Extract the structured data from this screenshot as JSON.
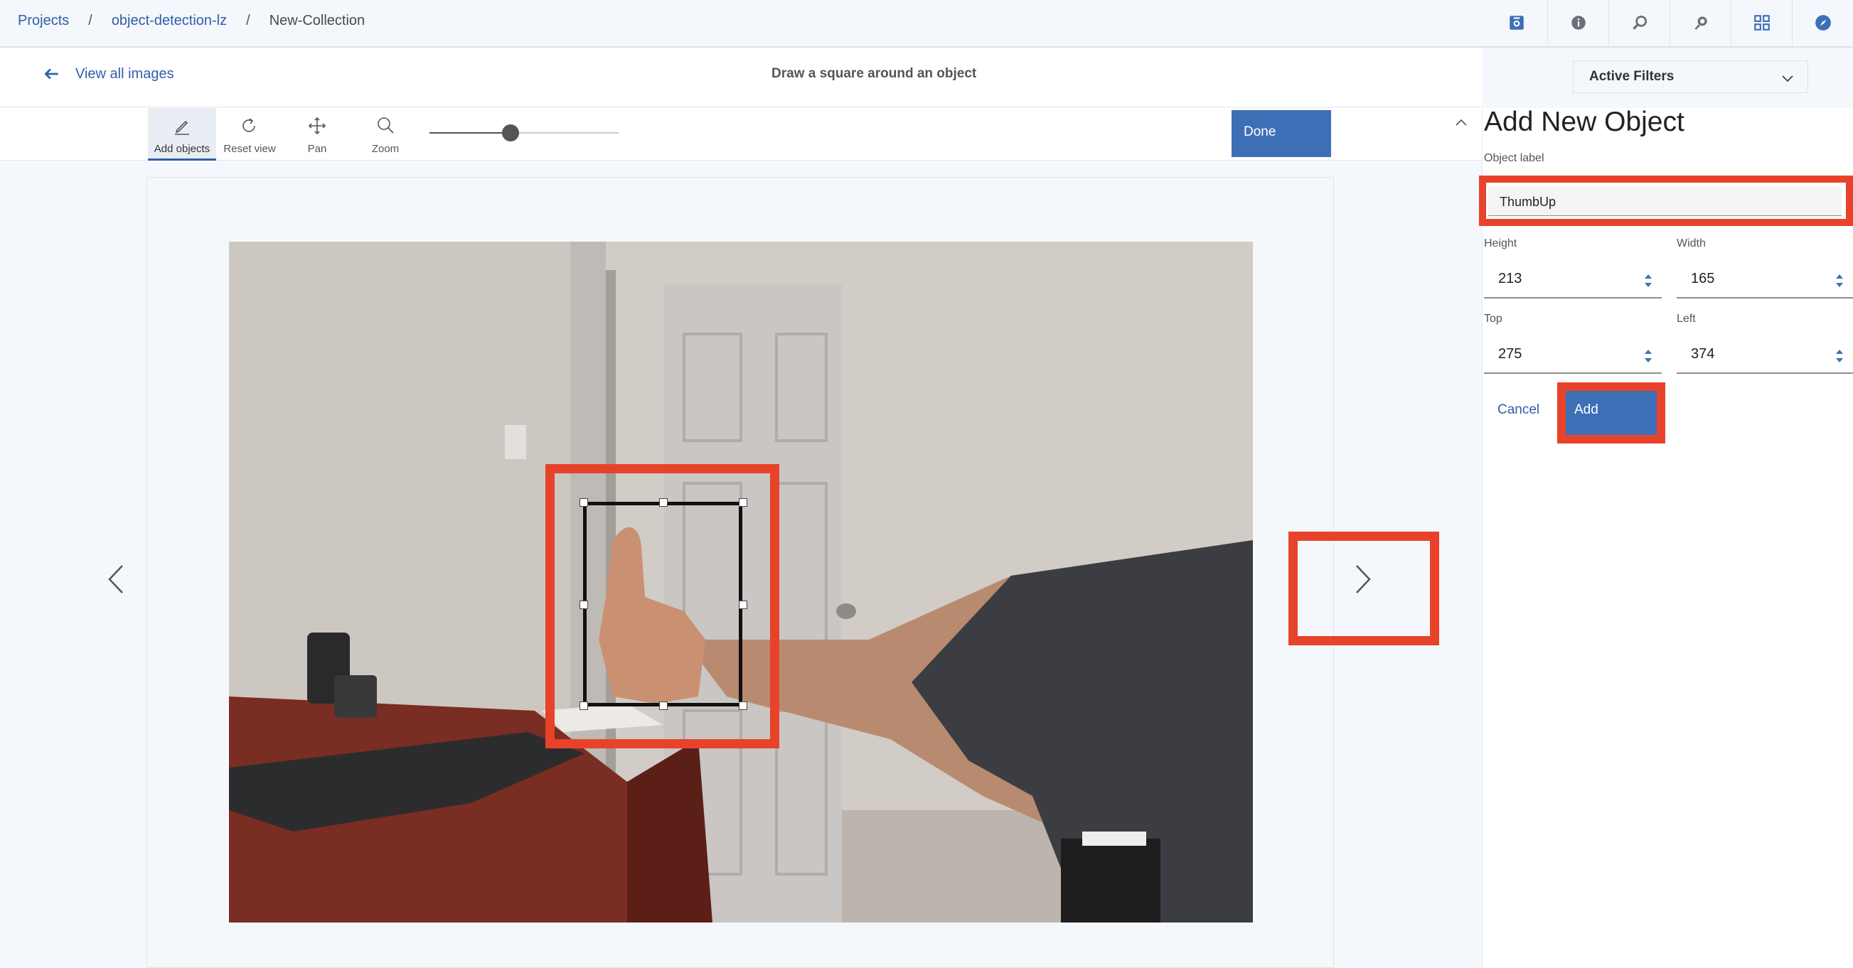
{
  "breadcrumb": {
    "items": [
      "Projects",
      "object-detection-lz",
      "New-Collection"
    ],
    "separator": "/"
  },
  "header_icons": [
    "camera-icon",
    "info-icon",
    "search-icon",
    "ideas-icon",
    "apps-grid-icon",
    "compass-icon"
  ],
  "subbar": {
    "back_label": "View all images",
    "instruction": "Draw a square around an object",
    "filters_label": "Active Filters"
  },
  "toolbar": {
    "tools": [
      {
        "label": "Add objects",
        "icon": "pencil-icon",
        "active": true
      },
      {
        "label": "Reset view",
        "icon": "reset-icon",
        "active": false
      },
      {
        "label": "Pan",
        "icon": "move-icon",
        "active": false
      },
      {
        "label": "Zoom",
        "icon": "zoom-icon",
        "active": false
      }
    ],
    "zoom_level_fraction": 0.43,
    "done_label": "Done"
  },
  "panel": {
    "title": "Add New Object",
    "object_label_caption": "Object label",
    "object_label_value": "ThumbUp",
    "height_label": "Height",
    "height_value": "213",
    "width_label": "Width",
    "width_value": "165",
    "top_label": "Top",
    "top_value": "275",
    "left_label": "Left",
    "left_value": "374",
    "cancel_label": "Cancel",
    "add_label": "Add"
  },
  "colors": {
    "accent": "#3d6fb6",
    "link": "#2f5fa8",
    "highlight": "#e8432a"
  }
}
